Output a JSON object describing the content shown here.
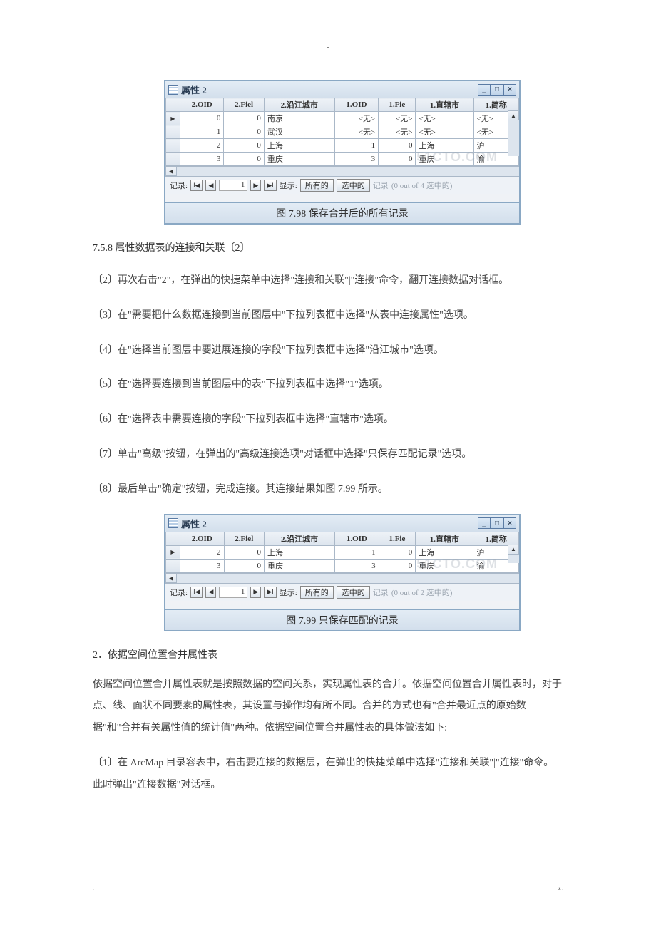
{
  "sectionHeading": "7.5.8  属性数据表的连接和关联〔2〕",
  "steps": [
    "〔2〕再次右击\"2\"，在弹出的快捷菜单中选择\"连接和关联\"|\"连接\"命令，翻开连接数据对话框。",
    "〔3〕在\"需要把什么数据连接到当前图层中\"下拉列表框中选择\"从表中连接属性\"选项。",
    "〔4〕在\"选择当前图层中要进展连接的字段\"下拉列表框中选择\"沿江城市\"选项。",
    "〔5〕在\"选择要连接到当前图层中的表\"下拉列表框中选择\"1\"选项。",
    "〔6〕在\"选择表中需要连接的字段\"下拉列表框中选择\"直辖市\"选项。",
    "〔7〕单击\"高级\"按钮，在弹出的\"高级连接选项\"对话框中选择\"只保存匹配记录\"选项。",
    "〔8〕最后单击\"确定\"按钮，完成连接。其连接结果如图 7.99 所示。"
  ],
  "figure1": {
    "title": "属性 2",
    "caption": "图 7.98  保存合并后的所有记录",
    "headers": [
      "",
      "2.OID",
      "2.Fiel",
      "2.沿江城市",
      "1.OID",
      "1.Fie",
      "1.直辖市",
      "1.简称"
    ],
    "rows": [
      {
        "sel": true,
        "c": [
          "0",
          "0",
          "南京",
          "<无>",
          "<无>",
          "<无>",
          "<无>"
        ]
      },
      {
        "sel": false,
        "c": [
          "1",
          "0",
          "武汉",
          "<无>",
          "<无>",
          "<无>",
          "<无>"
        ]
      },
      {
        "sel": false,
        "c": [
          "2",
          "0",
          "上海",
          "1",
          "0",
          "上海",
          "沪"
        ]
      },
      {
        "sel": false,
        "c": [
          "3",
          "0",
          "重庆",
          "3",
          "0",
          "重庆",
          "渝"
        ]
      }
    ],
    "pager": {
      "label": "记录:",
      "recnum": "1",
      "show": "显示:",
      "all": "所有的",
      "selected": "选中的",
      "records": "记录",
      "status": "(0 out of 4 选中的)"
    }
  },
  "figure2": {
    "title": "属性 2",
    "caption": "图 7.99  只保存匹配的记录",
    "headers": [
      "",
      "2.OID",
      "2.Fiel",
      "2.沿江城市",
      "1.OID",
      "1.Fie",
      "1.直辖市",
      "1.简称"
    ],
    "rows": [
      {
        "sel": true,
        "c": [
          "2",
          "0",
          "上海",
          "1",
          "0",
          "上海",
          "沪"
        ]
      },
      {
        "sel": false,
        "c": [
          "3",
          "0",
          "重庆",
          "3",
          "0",
          "重庆",
          "渝"
        ]
      }
    ],
    "pager": {
      "label": "记录:",
      "recnum": "1",
      "show": "显示:",
      "all": "所有的",
      "selected": "选中的",
      "records": "记录",
      "status": "(0 out of 2 选中的)"
    }
  },
  "subHeading": "2．依据空间位置合并属性表",
  "para1": "依据空间位置合并属性表就是按照数据的空间关系，实现属性表的合并。依据空间位置合并属性表时，对于点、线、面状不同要素的属性表，其设置与操作均有所不同。合并的方式也有\"合并最近点的原始数据\"和\"合并有关属性值的统计值\"两种。依据空间位置合并属性表的具体做法如下:",
  "para2": "〔1〕在 ArcMap 目录容表中，右击要连接的数据层，在弹出的快捷菜单中选择\"连接和关联\"|\"连接\"命令。此时弹出\"连接数据\"对话框。",
  "footer": {
    "left": ".",
    "right": "z."
  },
  "topDash": "-",
  "winbtns": {
    "min": "_",
    "max": "□",
    "close": "×"
  },
  "scrollUp": "▲",
  "watermark": "51CTO.COM"
}
